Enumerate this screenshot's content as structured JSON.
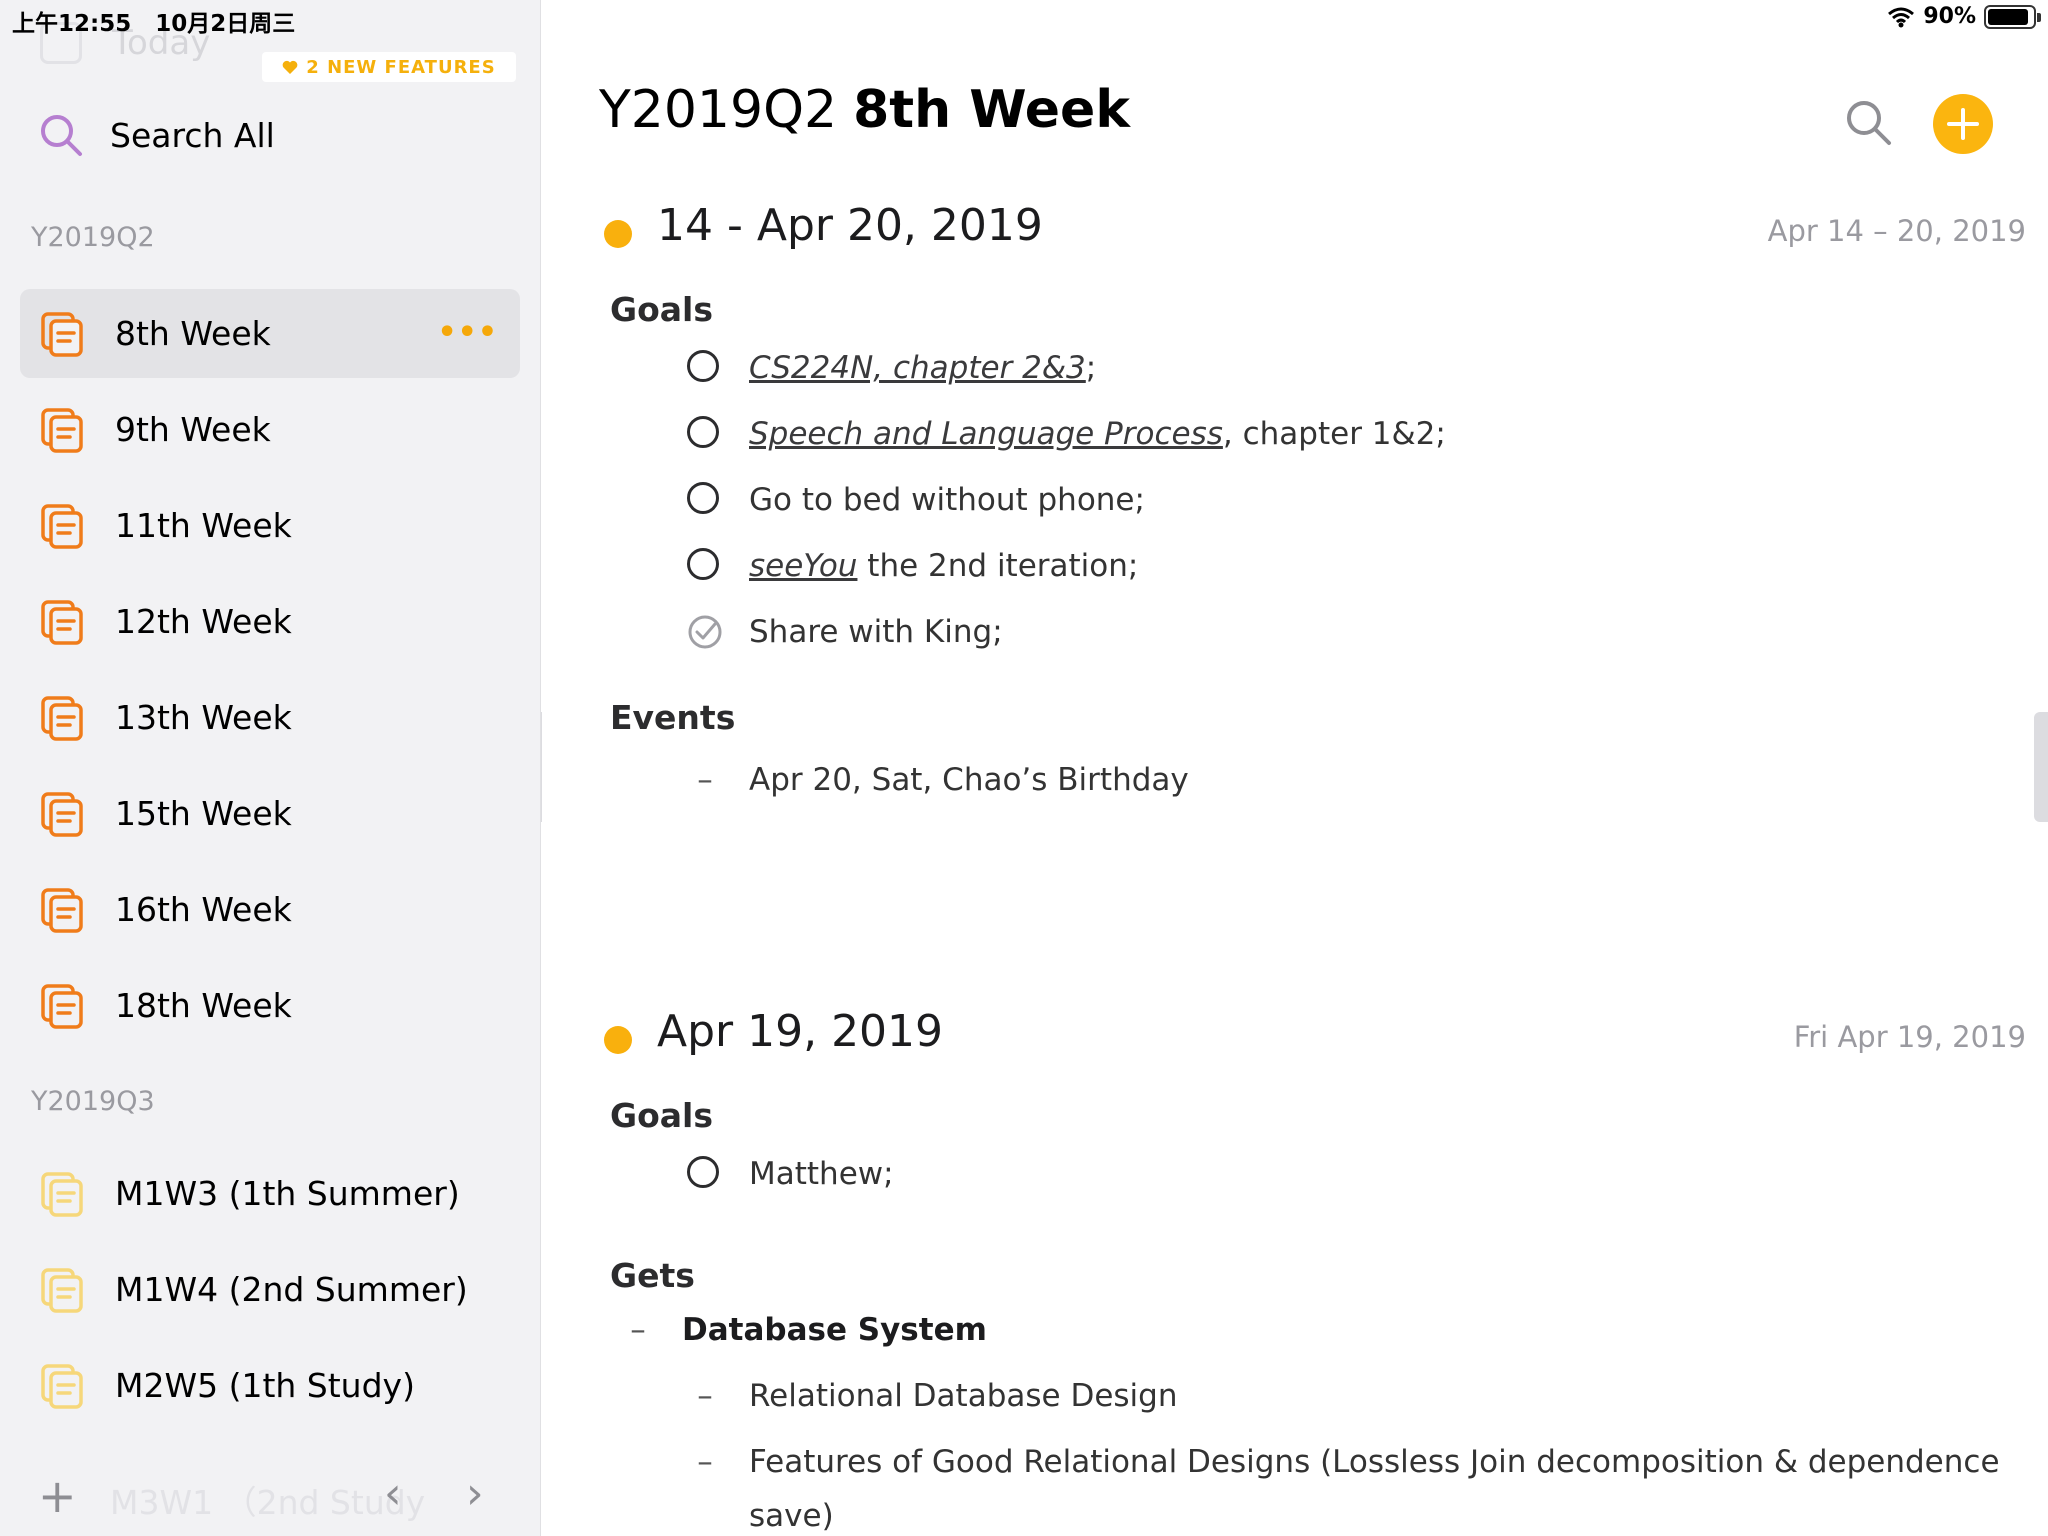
{
  "status_bar": {
    "time": "上午12:55",
    "date": "10月2日周三",
    "battery": "90%",
    "battery_level": 0.9
  },
  "sidebar": {
    "faded_item": "Today",
    "new_features": "2 NEW FEATURES",
    "search_all": "Search All",
    "sections": [
      {
        "label": "Y2019Q2",
        "items": [
          {
            "label": "8th Week",
            "selected": true
          },
          {
            "label": "9th Week"
          },
          {
            "label": "11th Week"
          },
          {
            "label": "12th Week"
          },
          {
            "label": "13th Week"
          },
          {
            "label": "15th Week"
          },
          {
            "label": "16th Week"
          },
          {
            "label": "18th Week"
          }
        ]
      },
      {
        "label": "Y2019Q3",
        "items": [
          {
            "label": "M1W3 (1th Summer)"
          },
          {
            "label": "M1W4 (2nd Summer)"
          },
          {
            "label": "M2W5 (1th Study)"
          }
        ]
      }
    ],
    "more_label": "•••",
    "bottom_ghost": "M3W1 （2nd Study",
    "add_symbol": "+",
    "prev_symbol": "‹",
    "next_symbol": "›",
    "icon": "document-stack-icon",
    "colors": {
      "accent": "#f07c1a",
      "faded": "#f6d77a"
    }
  },
  "main": {
    "title_prefix": "Y2019Q2",
    "title_name": "8th Week",
    "search_icon": "search-icon",
    "add_icon": "plus-circle-icon",
    "accent": "#fbb50f",
    "entries": [
      {
        "title": "14 - Apr 20, 2019",
        "date": "Apr 14 – 20, 2019",
        "goals_label": "Goals",
        "goals": [
          {
            "link": "CS224N, chapter 2&3",
            "text": ";",
            "done": false
          },
          {
            "link": "Speech and Language Process",
            "text": ", chapter 1&2;",
            "done": false
          },
          {
            "link": "",
            "text": "Go to bed without phone;",
            "done": false
          },
          {
            "link": "seeYou",
            "text": " the 2nd iteration;",
            "done": false
          },
          {
            "link": "",
            "text": "Share with King;",
            "done": true
          }
        ],
        "events_label": "Events",
        "events": [
          "Apr 20, Sat, Chao’s Birthday"
        ]
      },
      {
        "title": "Apr 19, 2019",
        "date": "Fri Apr 19, 2019",
        "goals_label": "Goals",
        "goals": [
          {
            "link": "",
            "text": "Matthew;",
            "done": false
          }
        ],
        "gets_label": "Gets",
        "gets_header": "Database System",
        "gets": [
          "Relational Database Design",
          "Features of Good Relational Designs (Lossless Join decomposition & dependence",
          "save)"
        ]
      }
    ]
  }
}
